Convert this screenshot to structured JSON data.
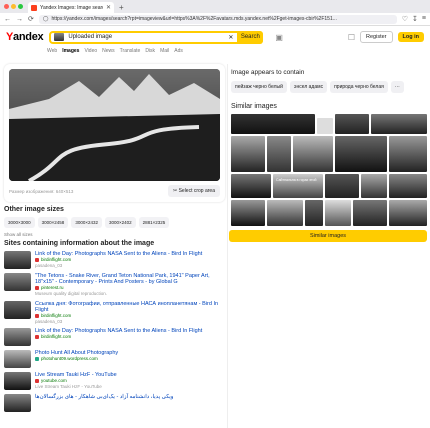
{
  "browser": {
    "tab_title": "Yandex Images: Image search",
    "tab_new": "+",
    "tab_close": "✕",
    "url": "https://yandex.com/images/search?rpt=imageview&url=https%3A%2F%2Favatars.mds.yandex.net%2Fget-images-cbir%2F151...",
    "back": "←",
    "forward": "→",
    "reload": "⟳"
  },
  "header": {
    "logo_first": "Y",
    "logo_rest": "andex",
    "search_text": "Uploaded image",
    "search_clear": "✕",
    "search_button": "Search",
    "register": "Register",
    "login": "Log in"
  },
  "services": [
    "Web",
    "Images",
    "Video",
    "News",
    "Translate",
    "Disk",
    "Mail",
    "Ads"
  ],
  "preview": {
    "size_text": "Размер изображения: 640×513",
    "crop_button": "Select crop area"
  },
  "sizes": {
    "title": "Other image sizes",
    "items": [
      "3000×3000",
      "3000×2458",
      "3000×2432",
      "3000×2402",
      "2881×2325"
    ],
    "show_all": "Show all sizes"
  },
  "sites": {
    "title": "Sites containing information about the image",
    "items": [
      {
        "title": "Link of the Day: Photographs NASA Sent to the Aliens - Bird In Flight",
        "domain": "birdinflight.com",
        "desc": "pasadena_03"
      },
      {
        "title": "\"The Tetons - Snake River, Grand Teton National Park, 1941\" Paper Art, 18\"x15\" - Contemporary - Prints And Posters - by Global G",
        "domain": "pinterest.ru",
        "desc": "Museum quality digital reproduction."
      },
      {
        "title": "Ссылка дня: Фотографии, отправленные НАСА инопланетянам - Bird In Flight",
        "domain": "birdinflight.com",
        "desc": "pasadena_03"
      },
      {
        "title": "Link of the Day: Photographs NASA Sent to the Aliens - Bird In Flight",
        "domain": "birdinflight.com",
        "desc": ""
      },
      {
        "title": "Photo Hunt All About Photography",
        "domain": "photohunt09.wordpress.com",
        "desc": ""
      },
      {
        "title": "Live Stream Tauki HzF - YouTube",
        "domain": "youtube.com",
        "desc": "Live Stream Tauki HzF - YouTube"
      },
      {
        "title": "ویکی پدیا، دانشنامه آزاد - یک‌ای‌بی شاهکار - های بزرگسالان‌ها",
        "domain": "",
        "desc": ""
      }
    ]
  },
  "contains": {
    "title": "Image appears to contain",
    "tags": [
      "пейзаж черно белый",
      "энсел адамс",
      "природа черно белая",
      "···"
    ]
  },
  "similar": {
    "title": "Similar images",
    "caption": "Сайтнальна в горах этой",
    "button": "Similar images"
  },
  "colors": {
    "accent": "#fc0",
    "logo_red": "#f00",
    "link": "#04b"
  }
}
